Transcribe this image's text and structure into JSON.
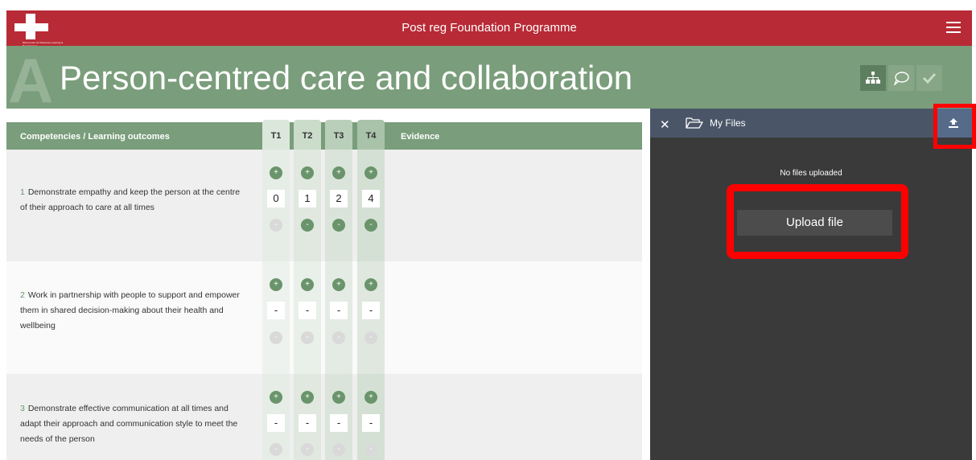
{
  "header": {
    "title": "Post reg Foundation Programme",
    "logo_text": "NHS Centre for Pharmacy Learning & Development",
    "brand_color": "#b82a35"
  },
  "hero": {
    "letter": "A",
    "title": "Person-centred care and collaboration",
    "color": "#7a9d7b"
  },
  "table": {
    "competency_header": "Competencies / Learning outcomes",
    "terms": [
      "T1",
      "T2",
      "T3",
      "T4"
    ],
    "evidence_header": "Evidence",
    "rows": [
      {
        "number": "1",
        "text": "Demonstrate empathy and keep the person at the centre of their approach to care at all times",
        "values": [
          "0",
          "1",
          "2",
          "4"
        ]
      },
      {
        "number": "2",
        "text": "Work in partnership with people to support and empower them in shared decision-making about their health and wellbeing",
        "values": [
          "-",
          "-",
          "-",
          "-"
        ]
      },
      {
        "number": "3",
        "text": "Demonstrate effective communication at all times and adapt their approach and communication style to meet the needs of the person",
        "values": [
          "-",
          "-",
          "-",
          "-"
        ]
      }
    ],
    "plus_symbol": "+",
    "minus_symbol": "-"
  },
  "files_panel": {
    "title": "My Files",
    "close_symbol": "✕",
    "empty_message": "No files uploaded",
    "upload_label": "Upload file"
  },
  "colors": {
    "highlight": "#ff0000",
    "panel_bg": "#3a3a3a",
    "panel_header": "#4a5668"
  }
}
